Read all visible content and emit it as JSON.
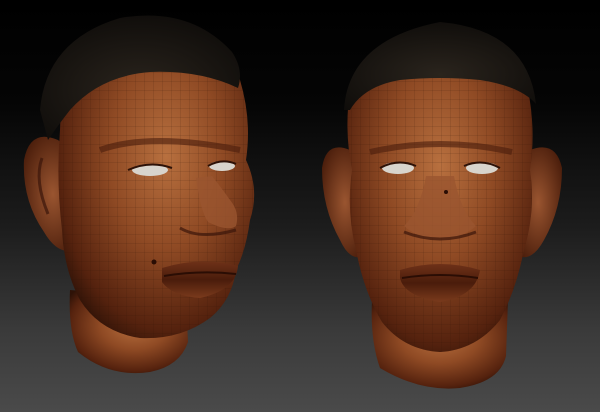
{
  "scene": {
    "view_count": 2,
    "colors": {
      "background_top": "#000000",
      "background_bottom": "#4a4a4a",
      "skin_highlight": "#b0663a",
      "skin_mid": "#8a4522",
      "skin_shadow": "#3a160a",
      "hair": "#15120f",
      "eye_white": "#d8d4cc",
      "wireframe": "#2a0f05"
    },
    "views": [
      {
        "label": "three-quarter-left"
      },
      {
        "label": "front"
      }
    ]
  }
}
